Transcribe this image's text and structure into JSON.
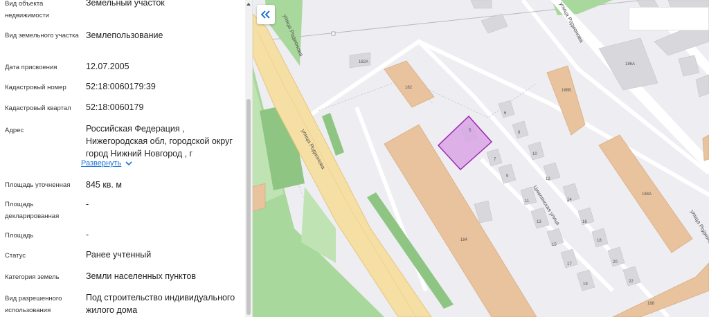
{
  "fields": [
    {
      "label": "Вид объекта недвижимости",
      "value": "Земельный участок"
    },
    {
      "label": "Вид земельного участка",
      "value": "Землепользование"
    },
    {
      "label": "Дата присвоения",
      "value": "12.07.2005"
    },
    {
      "label": "Кадастровый номер",
      "value": "52:18:0060179:39"
    },
    {
      "label": "Кадастровый квартал",
      "value": "52:18:0060179"
    },
    {
      "label": "Адрес",
      "value": "Российская Федерация , Нижегородская обл, городской округ город Нижний Новгород , г"
    },
    {
      "label": "Площадь уточненная",
      "value": "845 кв. м"
    },
    {
      "label": "Площадь декларированная",
      "value": "-"
    },
    {
      "label": "Площадь",
      "value": "-"
    },
    {
      "label": "Статус",
      "value": "Ранее учтенный"
    },
    {
      "label": "Категория земель",
      "value": "Земли населенных пунктов"
    },
    {
      "label": "Вид разрешенного использования",
      "value": "Под строительство индивидуального жилого дома"
    }
  ],
  "expand_link": "Развернуть",
  "icons": {
    "collapse": "double-chevron-left-icon",
    "expand": "chevron-down-icon",
    "scroll_up": "triangle-up-icon"
  },
  "map": {
    "streets": {
      "rodionova_1": "улица Родионова",
      "rodionova_2": "улица Родионова",
      "rodionova_3": "улица Родионова",
      "rodionova_4": "улица Родионова",
      "tsimlyanskaya": "Цимлянская улица"
    },
    "buildings": {
      "b182a": "182А",
      "b182": "182",
      "b184": "184",
      "b186a": "186А",
      "b188b": "188Б",
      "b188a": "188А",
      "b188": "188",
      "h5": "5",
      "h6": "6",
      "h7": "7",
      "h8": "8",
      "h9": "9",
      "h10": "10",
      "h11": "11",
      "h12": "12",
      "h13": "13",
      "h14": "14",
      "h15": "15",
      "h16": "16",
      "h17": "17",
      "h18": "18",
      "h19": "19",
      "h20": "20",
      "h22": "22"
    }
  },
  "colors": {
    "parcel_fill": "#d9a6e6",
    "parcel_stroke": "#9c27b0",
    "building": "#e8c39e",
    "park": "#a8d89b",
    "road": "#f6dfa4",
    "link": "#1a73d9"
  }
}
